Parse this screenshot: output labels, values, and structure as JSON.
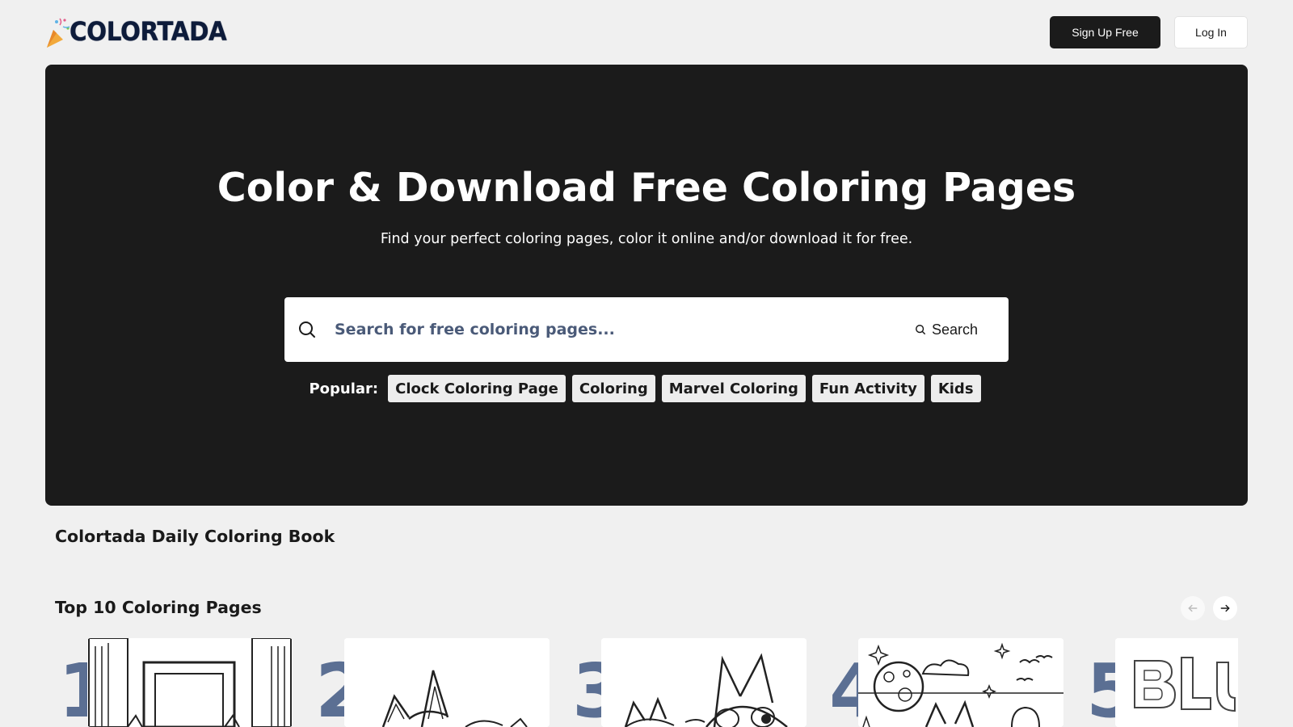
{
  "header": {
    "logo_text": "COLORTADA",
    "signup_label": "Sign Up Free",
    "login_label": "Log In"
  },
  "hero": {
    "title": "Color & Download Free Coloring Pages",
    "subtitle": "Find your perfect coloring pages, color it online and/or download it for free.",
    "search": {
      "placeholder": "Search for free coloring pages...",
      "value": "",
      "button_label": "Search"
    },
    "popular": {
      "label": "Popular:",
      "tags": [
        "Clock Coloring Page",
        "Coloring",
        "Marvel Coloring",
        "Fun Activity",
        "Kids"
      ]
    }
  },
  "daily": {
    "title": "Colortada Daily Coloring Book"
  },
  "top10": {
    "title": "Top 10 Coloring Pages",
    "items": [
      {
        "rank": "1",
        "icon": "doorway-cat-drawing"
      },
      {
        "rank": "2",
        "icon": "cartoon-dog-drawing"
      },
      {
        "rank": "3",
        "icon": "cartoon-dogs-drawing"
      },
      {
        "rank": "4",
        "icon": "night-moon-drawing"
      },
      {
        "rank": "5",
        "icon": "bubble-letters-drawing"
      }
    ]
  },
  "colors": {
    "hero_bg": "#1b1b1b",
    "page_bg": "#f0f0f0",
    "rank_number": "#5b6f93"
  }
}
